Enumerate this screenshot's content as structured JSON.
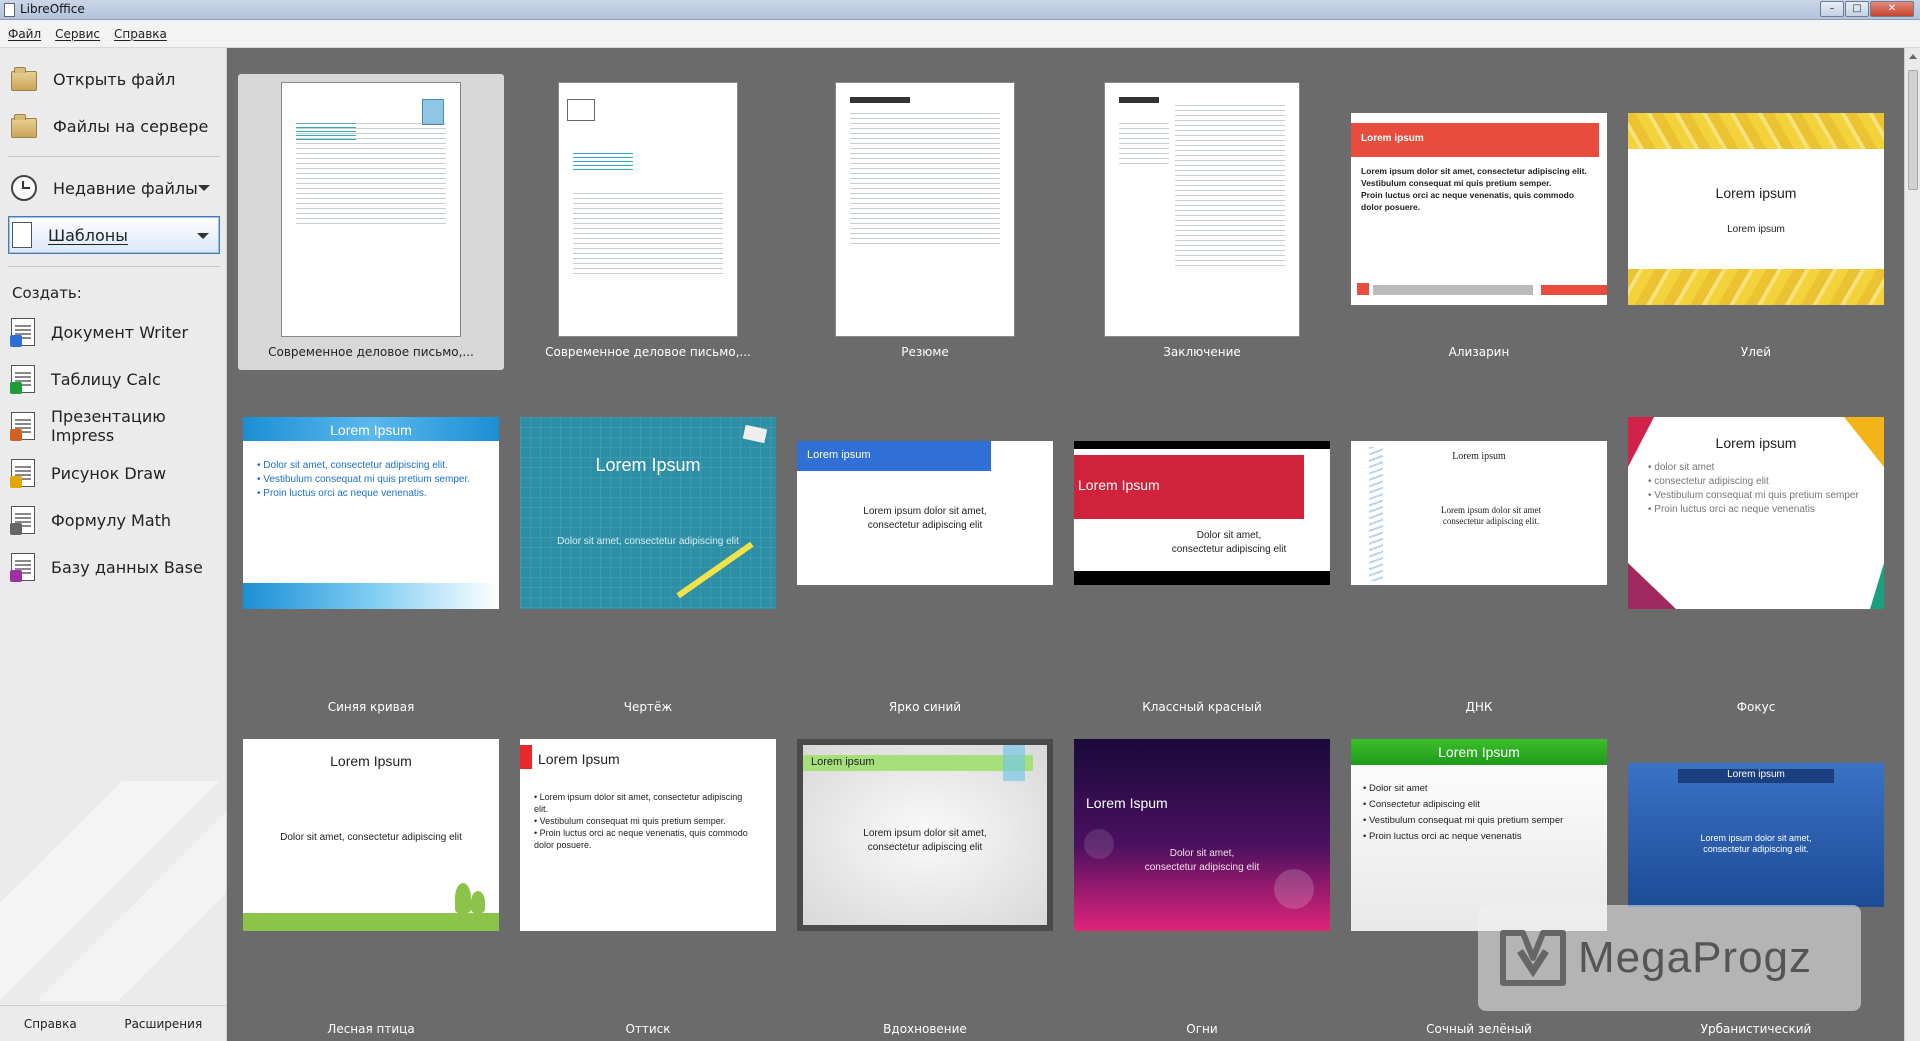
{
  "window": {
    "title": "LibreOffice"
  },
  "menu": [
    "Файл",
    "Сервис",
    "Справка"
  ],
  "sidebar": {
    "open_file": "Открыть файл",
    "remote_files": "Файлы на сервере",
    "recent_files": "Недавние файлы",
    "templates": "Шаблоны",
    "create_caption": "Создать:",
    "create_items": [
      {
        "label": "Документ Writer",
        "icon": "writer-icon",
        "color": "#2a6fd1"
      },
      {
        "label": "Таблицу Calc",
        "icon": "calc-icon",
        "color": "#1f9b3a"
      },
      {
        "label": "Презентацию Impress",
        "icon": "impress-icon",
        "color": "#d2601e"
      },
      {
        "label": "Рисунок Draw",
        "icon": "draw-icon",
        "color": "#e0a800"
      },
      {
        "label": "Формулу Math",
        "icon": "math-icon",
        "color": "#666666"
      },
      {
        "label": "Базу данных Base",
        "icon": "base-icon",
        "color": "#a12fa4"
      }
    ],
    "help": "Справка",
    "extensions": "Расширения"
  },
  "templates": [
    {
      "label": "Современное деловое письмо,...",
      "kind": "doc1",
      "selected": true
    },
    {
      "label": "Современное деловое письмо,...",
      "kind": "doc2"
    },
    {
      "label": "Резюме",
      "kind": "doc3"
    },
    {
      "label": "Заключение",
      "kind": "doc4"
    },
    {
      "label": "Ализарин",
      "kind": "alizarin",
      "title": "Lorem ipsum",
      "body": [
        "Lorem ipsum dolor sit amet, consectetur adipiscing elit.",
        "Vestibulum consequat mi quis pretium semper.",
        "Proin luctus orci ac neque venenatis, quis commodo dolor posuere."
      ]
    },
    {
      "label": "Улей",
      "kind": "hive",
      "title": "Lorem ipsum",
      "body": [
        "Lorem ipsum"
      ]
    },
    {
      "label": "Синяя кривая",
      "kind": "bluecurve",
      "title": "Lorem Ipsum",
      "body": [
        "Dolor sit amet, consectetur adipiscing elit.",
        "Vestibulum consequat mi quis pretium semper.",
        "Proin luctus orci ac neque venenatis."
      ]
    },
    {
      "label": "Чертёж",
      "kind": "blueprint",
      "title": "Lorem Ipsum",
      "body": [
        "Dolor sit amet, consectetur adipiscing elit"
      ]
    },
    {
      "label": "Ярко синий",
      "kind": "brightblue",
      "title": "Lorem ipsum",
      "body": [
        "Lorem ipsum dolor sit amet,",
        "consectetur adipiscing elit"
      ]
    },
    {
      "label": "Классный красный",
      "kind": "classyred",
      "title": "Lorem Ipsum",
      "body": [
        "Dolor sit amet,",
        "consectetur adipiscing elit"
      ]
    },
    {
      "label": "ДНК",
      "kind": "dna",
      "title": "Lorem ipsum",
      "body": [
        "Lorem ipsum dolor sit amet",
        "consectetur adipiscing elit."
      ]
    },
    {
      "label": "Фокус",
      "kind": "focus",
      "title": "Lorem ipsum",
      "body": [
        "dolor sit amet",
        "consectetur adipiscing elit",
        "Vestibulum consequat mi quis pretium semper",
        "Proin luctus orci ac neque venenatis"
      ]
    },
    {
      "label": "Лесная птица",
      "kind": "forestbird",
      "title": "Lorem Ipsum",
      "body": [
        "Dolor sit amet, consectetur adipiscing elit"
      ]
    },
    {
      "label": "Оттиск",
      "kind": "imprint",
      "title": "Lorem Ipsum",
      "body": [
        "Lorem ipsum dolor sit amet, consectetur adipiscing elit.",
        "Vestibulum consequat mi quis pretium semper.",
        "Proin luctus orci ac neque venenatis, quis commodo dolor posuere."
      ]
    },
    {
      "label": "Вдохновение",
      "kind": "inspiration",
      "title": "Lorem ipsum",
      "body": [
        "Lorem ipsum dolor sit amet,",
        "consectetur adipiscing elit"
      ]
    },
    {
      "label": "Огни",
      "kind": "lights",
      "title": "Lorem Ispum",
      "body": [
        "Dolor sit amet,",
        "consectetur adipiscing elit"
      ]
    },
    {
      "label": "Сочный зелёный",
      "kind": "juicygreen",
      "title": "Lorem Ipsum",
      "body": [
        "Dolor sit amet",
        "Consectetur adipiscing elit",
        "Vestibulum consequat mi quis pretium semper",
        "Proin luctus orci ac neque venenatis"
      ]
    },
    {
      "label": "Урбанистический",
      "kind": "urban",
      "title": "Lorem ipsum",
      "body": [
        "Lorem ipsum dolor sit amet,",
        "consectetur adipiscing elit."
      ]
    }
  ],
  "watermark": {
    "text": "MegaProgz"
  }
}
